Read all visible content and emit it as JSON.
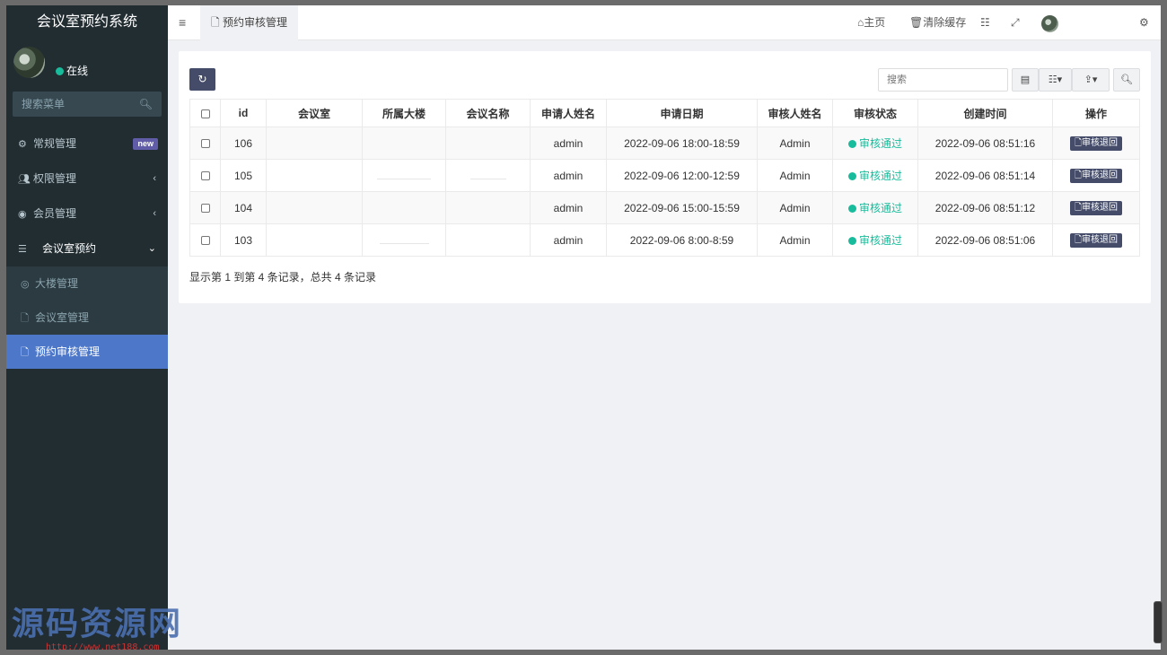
{
  "brand": "会议室预约系统",
  "user": {
    "status": "在线"
  },
  "sidebar": {
    "search_placeholder": "搜索菜单",
    "items": [
      {
        "label": "常规管理",
        "icon": "cogs-icon",
        "badge": "new"
      },
      {
        "label": "权限管理",
        "icon": "group-icon"
      },
      {
        "label": "会员管理",
        "icon": "user-circle-icon"
      },
      {
        "label": "会议室预约",
        "icon": "list-icon"
      }
    ],
    "subitems": [
      {
        "label": "大楼管理",
        "icon": "circle-icon"
      },
      {
        "label": "会议室管理",
        "icon": "file-icon"
      },
      {
        "label": "预约审核管理",
        "icon": "file-icon",
        "active": true
      }
    ]
  },
  "header": {
    "tab_label": "预约审核管理",
    "home": "主页",
    "clear_cache": "清除缓存"
  },
  "toolbar": {
    "search_placeholder": "搜索"
  },
  "table": {
    "columns": [
      "id",
      "会议室",
      "所属大楼",
      "会议名称",
      "申请人姓名",
      "申请日期",
      "审核人姓名",
      "审核状态",
      "创建时间",
      "操作"
    ],
    "rows": [
      {
        "id": "106",
        "applicant": "admin",
        "date": "2022-09-06 18:00-18:59",
        "reviewer": "Admin",
        "status": "审核通过",
        "created": "2022-09-06 08:51:16",
        "action": "审核退回"
      },
      {
        "id": "105",
        "applicant": "admin",
        "date": "2022-09-06 12:00-12:59",
        "reviewer": "Admin",
        "status": "审核通过",
        "created": "2022-09-06 08:51:14",
        "action": "审核退回"
      },
      {
        "id": "104",
        "applicant": "admin",
        "date": "2022-09-06 15:00-15:59",
        "reviewer": "Admin",
        "status": "审核通过",
        "created": "2022-09-06 08:51:12",
        "action": "审核退回"
      },
      {
        "id": "103",
        "applicant": "admin",
        "date": "2022-09-06 8:00-8:59",
        "reviewer": "Admin",
        "status": "审核通过",
        "created": "2022-09-06 08:51:06",
        "action": "审核退回"
      }
    ],
    "summary": "显示第 1 到第 4 条记录，总共 4 条记录"
  },
  "watermark": {
    "text": "源码资源网",
    "url": "http://www.net188.com"
  },
  "colors": {
    "accent": "#444c69",
    "active": "#4d77c9",
    "success": "#18bc9c",
    "sidebar": "#222d32"
  }
}
